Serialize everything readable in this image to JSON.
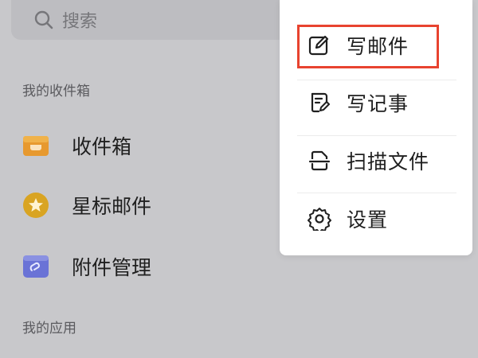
{
  "search": {
    "placeholder": "搜索"
  },
  "sections": {
    "inbox_title": "我的收件箱",
    "apps_title": "我的应用"
  },
  "inbox_items": [
    {
      "label": "收件箱",
      "icon": "inbox-tray-icon"
    },
    {
      "label": "星标邮件",
      "icon": "star-badge-icon"
    },
    {
      "label": "附件管理",
      "icon": "attachment-folder-icon"
    }
  ],
  "menu": {
    "items": [
      {
        "label": "写邮件",
        "icon": "compose-icon"
      },
      {
        "label": "写记事",
        "icon": "note-icon"
      },
      {
        "label": "扫描文件",
        "icon": "scan-document-icon"
      },
      {
        "label": "设置",
        "icon": "gear-icon"
      }
    ]
  },
  "colors": {
    "highlight": "#e8432f",
    "inbox_icon": "#e7992f",
    "star_icon": "#d9a422",
    "attachment_icon": "#6a73d6"
  }
}
